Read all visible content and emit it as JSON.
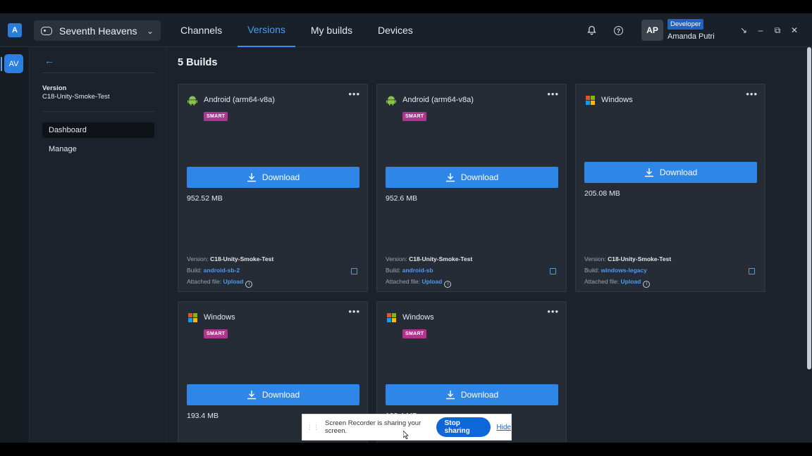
{
  "topbar": {
    "logo_text": "A",
    "project_name": "Seventh Heavens",
    "tabs": [
      {
        "label": "Channels",
        "active": false
      },
      {
        "label": "Versions",
        "active": true
      },
      {
        "label": "My builds",
        "active": false
      },
      {
        "label": "Devices",
        "active": false
      }
    ],
    "user": {
      "initials": "AP",
      "role": "Developer",
      "name": "Amanda Putri"
    }
  },
  "rail": {
    "app_initials": "AV"
  },
  "sidebar": {
    "back_icon": "arrow-left-icon",
    "version_label": "Version",
    "version_value": "C18-Unity-Smoke-Test",
    "items": [
      {
        "label": "Dashboard",
        "active": true
      },
      {
        "label": "Manage",
        "active": false
      }
    ]
  },
  "main": {
    "heading": "5 Builds",
    "download_label": "Download",
    "smart_label": "SMART",
    "builds": [
      {
        "platform": "Android (arm64-v8a)",
        "icon": "android-icon",
        "smart": true,
        "size": "952.52 MB",
        "version_label": "Version:",
        "version": "C18-Unity-Smoke-Test",
        "build_label": "Build:",
        "build": "android-sb-2",
        "attached_label": "Attached file:",
        "attached": "Upload"
      },
      {
        "platform": "Android (arm64-v8a)",
        "icon": "android-icon",
        "smart": true,
        "size": "952.6 MB",
        "version_label": "Version:",
        "version": "C18-Unity-Smoke-Test",
        "build_label": "Build:",
        "build": "android-sb",
        "attached_label": "Attached file:",
        "attached": "Upload"
      },
      {
        "platform": "Windows",
        "icon": "windows-icon",
        "smart": false,
        "size": "205.08 MB",
        "version_label": "Version:",
        "version": "C18-Unity-Smoke-Test",
        "build_label": "Build:",
        "build": "windows-legacy",
        "attached_label": "Attached file:",
        "attached": "Upload"
      },
      {
        "platform": "Windows",
        "icon": "windows-icon",
        "smart": true,
        "size": "193.4 MB"
      },
      {
        "platform": "Windows",
        "icon": "windows-icon",
        "smart": true,
        "size": "193.4 MB"
      }
    ]
  },
  "share_bar": {
    "message": "Screen Recorder is sharing your screen.",
    "stop_label": "Stop sharing",
    "hide_label": "Hide"
  },
  "colors": {
    "accent": "#2e86e6",
    "smart_badge": "#b0358f",
    "background": "#1c222b",
    "card": "#252c36"
  }
}
